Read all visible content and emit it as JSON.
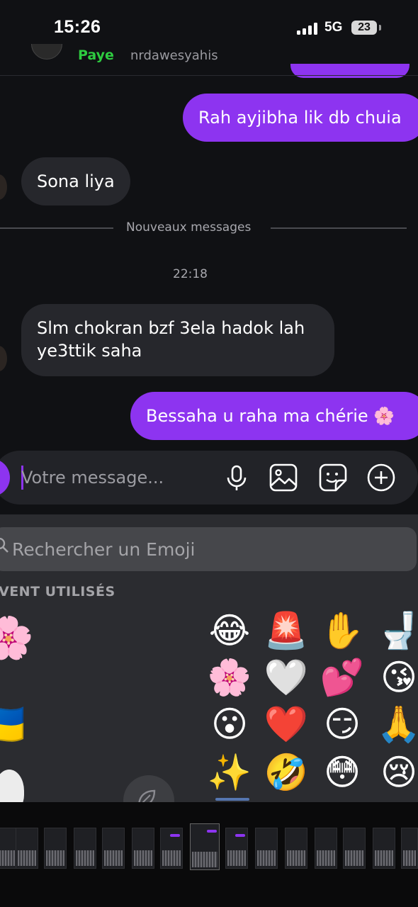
{
  "status_bar": {
    "time": "15:26",
    "network": "5G",
    "battery": "23"
  },
  "header": {
    "name_partial": "Paye",
    "subtitle_partial": "nrdawesyahis"
  },
  "messages": [
    {
      "direction": "sent",
      "text": "Rah ayjibha lik db chuia"
    },
    {
      "direction": "received",
      "text": "Sona liya"
    },
    {
      "direction": "received",
      "text": "Slm chokran bzf 3ela hadok lah ye3ttik saha"
    },
    {
      "direction": "sent",
      "text": "Bessaha u raha ma chérie 🌸"
    }
  ],
  "divider_label": "Nouveaux messages",
  "timestamp": "22:18",
  "composer": {
    "placeholder": "Votre message..."
  },
  "emoji_panel": {
    "search_placeholder": "Rechercher un Emoji",
    "section_title": "VENT UTILISÉS",
    "left_column": [
      "🌸",
      "🇺🇦"
    ],
    "grid": [
      [
        "😂",
        "🚨",
        "✋",
        "🚽"
      ],
      [
        "🌸",
        "🤍",
        "💕",
        "😘"
      ],
      [
        "😮",
        "❤️",
        "😏",
        "🙏"
      ],
      [
        "✨",
        "🤣",
        "😳",
        "😢"
      ]
    ]
  },
  "accent_color": "#8d34f0"
}
